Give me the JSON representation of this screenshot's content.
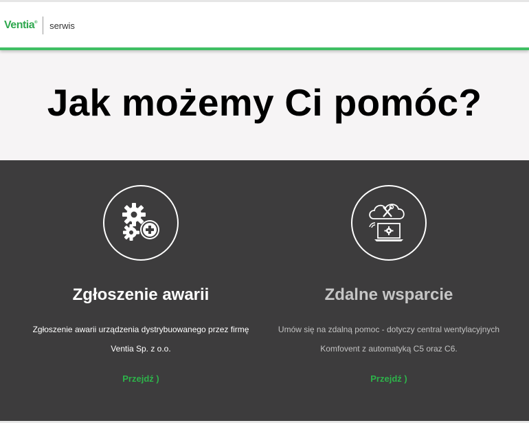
{
  "header": {
    "logo_text": "Ventia",
    "logo_mark": "®",
    "service_label": "serwis"
  },
  "hero": {
    "title": "Jak możemy Ci pomóc?"
  },
  "cards": [
    {
      "icon": "gears-plus-icon",
      "title": "Zgłoszenie awarii",
      "description": "Zgłoszenie awarii urządzenia dystrybuowanego przez firmę Ventia Sp. z o.o.",
      "link": "Przejdź )"
    },
    {
      "icon": "cloud-laptop-icon",
      "title": "Zdalne wsparcie",
      "description": "Umów się na zdalną pomoc - dotyczy central wentylacyjnych Komfovent z automatyką C5 oraz C6.",
      "link": "Przejdź )"
    }
  ],
  "colors": {
    "brand_green": "#2fa84f",
    "accent_line": "#3fbf63",
    "dark_bg": "#3d3c3d",
    "hero_bg": "#f6f4f5"
  }
}
